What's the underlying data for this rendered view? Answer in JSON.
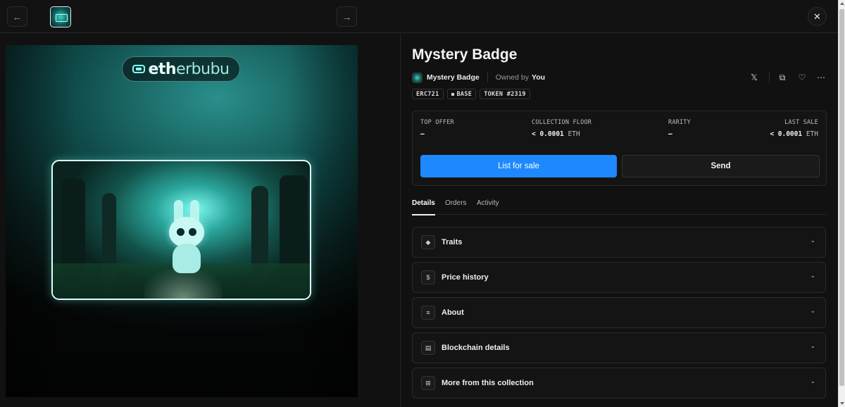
{
  "header": {
    "prev_icon": "←",
    "next_icon": "→",
    "close_icon": "✕"
  },
  "artwork": {
    "logo_text_bold": "eth",
    "logo_text_light": "erbubu"
  },
  "item": {
    "title": "Mystery Badge",
    "collection_name": "Mystery Badge",
    "owned_label": "Owned by",
    "owner": "You"
  },
  "actions": {
    "x_icon": "𝕏",
    "copy_icon": "⧉",
    "like_icon": "♡",
    "more_icon": "⋯"
  },
  "tags": {
    "standard": "ERC721",
    "chain": "BASE",
    "token": "TOKEN #2319"
  },
  "stats": {
    "top_offer_label": "TOP OFFER",
    "top_offer_value": "—",
    "floor_label": "COLLECTION FLOOR",
    "floor_value": "< 0.0001",
    "floor_unit": "ETH",
    "rarity_label": "RARITY",
    "rarity_value": "—",
    "last_sale_label": "LAST SALE",
    "last_sale_value": "< 0.0001",
    "last_sale_unit": "ETH"
  },
  "buttons": {
    "list_for_sale": "List for sale",
    "send": "Send"
  },
  "tabs": [
    {
      "label": "Details"
    },
    {
      "label": "Orders"
    },
    {
      "label": "Activity"
    }
  ],
  "accordions": [
    {
      "label": "Traits",
      "icon": "◆"
    },
    {
      "label": "Price history",
      "icon": "$"
    },
    {
      "label": "About",
      "icon": "≡"
    },
    {
      "label": "Blockchain details",
      "icon": "▤"
    },
    {
      "label": "More from this collection",
      "icon": "⊞"
    }
  ],
  "chevron": "⌄",
  "colors": {
    "background": "#111111",
    "accent": "#1e88ff",
    "card": "#141414",
    "border": "#2a2a2a"
  }
}
